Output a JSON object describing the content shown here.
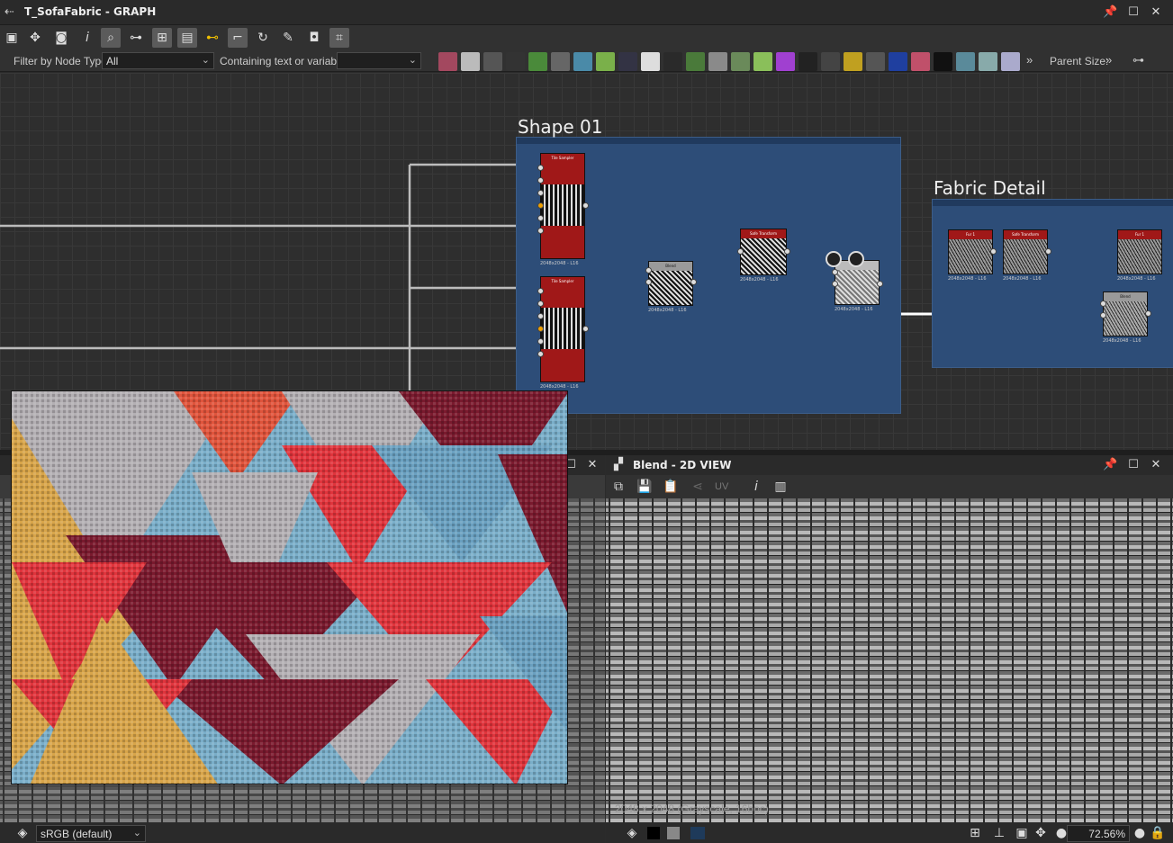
{
  "window": {
    "title": "T_SofaFabric - GRAPH"
  },
  "filter_bar": {
    "filter_label": "Filter by Node Type",
    "filter_value": "All",
    "text_label": "Containing text or variable",
    "text_value": "",
    "parent_size_label": "Parent Size:",
    "more_glyph": "»"
  },
  "graph": {
    "frames": [
      {
        "title": "Shape 01"
      },
      {
        "title": "Fabric Detail"
      }
    ],
    "nodes": [
      {
        "label": "Tile Sampler",
        "resolution": "2048x2048 - L16"
      },
      {
        "label": "Tile Sampler",
        "resolution": "2048x2048 - L16"
      },
      {
        "label": "Blend",
        "resolution": "2048x2048 - L16"
      },
      {
        "label": "Safe Transform Grayscale",
        "resolution": "2048x2048 - L16"
      },
      {
        "label": "",
        "resolution": "2048x2048 - L16"
      },
      {
        "label": "Fur 1",
        "resolution": "2048x2048 - L16"
      },
      {
        "label": "Safe Transform Grayscale",
        "resolution": "2048x2048 - L16"
      },
      {
        "label": "Fur 1",
        "resolution": "2048x2048 - L16"
      },
      {
        "label": "Blend",
        "resolution": "2048x2048 - L16"
      }
    ]
  },
  "view2d": {
    "title": "Blend - 2D VIEW",
    "uv_label": "UV",
    "info": "2048 x 2048 (Grayscale, 16bpc)",
    "zoom": "72.56%"
  },
  "status": {
    "colorspace": "sRGB (default)"
  },
  "colors": {
    "frame_blue": "#2d4d78",
    "node_red": "#a01818"
  },
  "icons": {
    "toolbar": [
      "frame-all-icon",
      "fit-icon",
      "camera-icon",
      "info-icon",
      "search-icon",
      "link-icon",
      "layout-icon",
      "panel-icon",
      "connect-icon",
      "route-icon",
      "rotate-icon",
      "tools-icon",
      "display-icon",
      "crop-icon"
    ]
  }
}
